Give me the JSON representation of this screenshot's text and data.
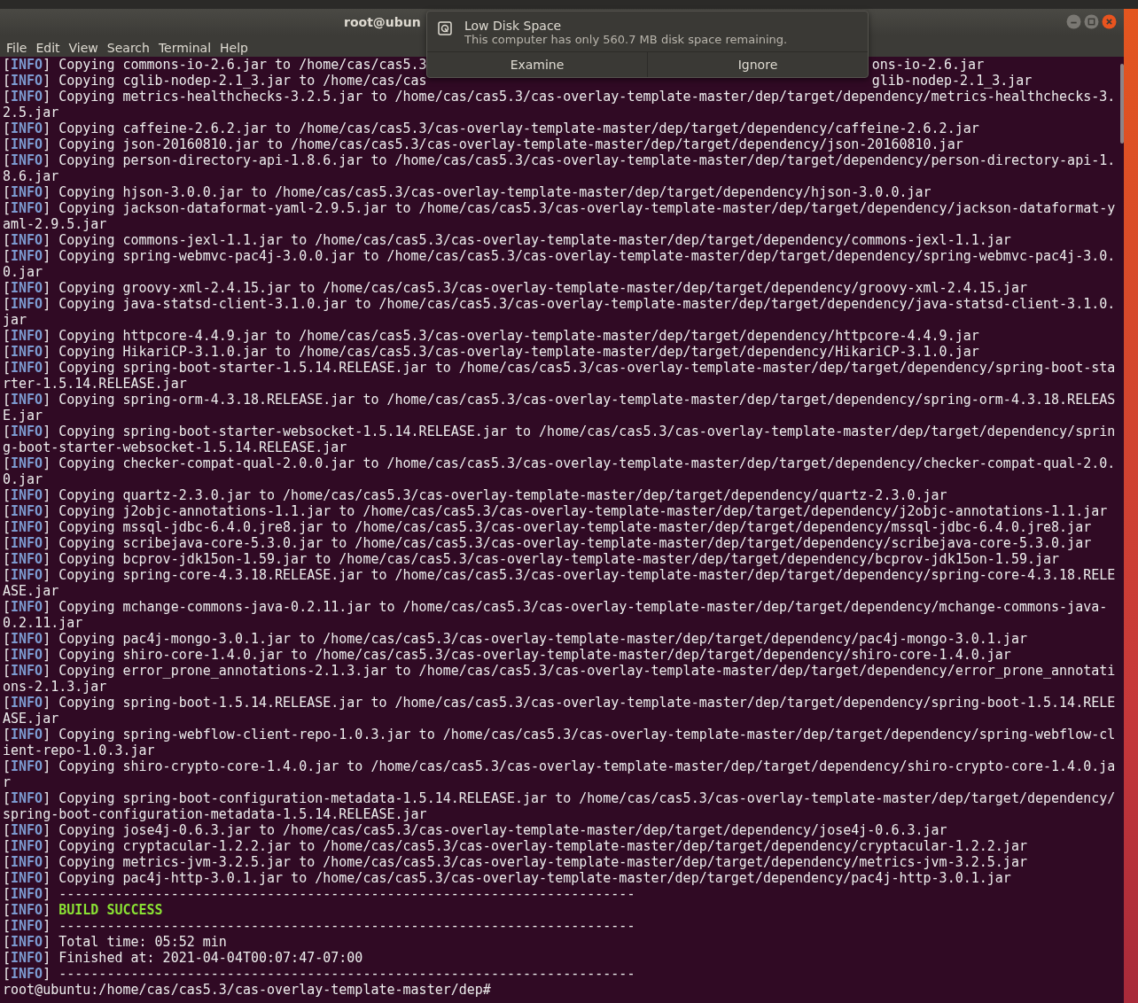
{
  "window": {
    "title": "root@ubun"
  },
  "menu": [
    "File",
    "Edit",
    "View",
    "Search",
    "Terminal",
    "Help"
  ],
  "notification": {
    "title": "Low Disk Space",
    "body": "This computer has only 560.7 MB disk space remaining.",
    "buttons": [
      "Examine",
      "Ignore"
    ]
  },
  "terminal": {
    "lines": [
      {
        "kind": "normal",
        "open": "[",
        "tag": "INFO",
        "close": "]",
        "text": "Copying commons-io-2.6.jar to /home/cas/cas5.3",
        "text_after_popup": "ons-io-2.6.jar"
      },
      {
        "kind": "normal",
        "open": "[",
        "tag": "INFO",
        "close": "]",
        "text": "Copying cglib-nodep-2.1_3.jar to /home/cas/cas",
        "text_after_popup": "glib-nodep-2.1_3.jar"
      },
      {
        "kind": "normal",
        "open": "[",
        "tag": "INFO",
        "close": "]",
        "text": "Copying metrics-healthchecks-3.2.5.jar to /home/cas/cas5.3/cas-overlay-template-master/dep/target/dependency/metrics-healthchecks-3.2.5.jar"
      },
      {
        "kind": "normal",
        "open": "[",
        "tag": "INFO",
        "close": "]",
        "text": "Copying caffeine-2.6.2.jar to /home/cas/cas5.3/cas-overlay-template-master/dep/target/dependency/caffeine-2.6.2.jar"
      },
      {
        "kind": "normal",
        "open": "[",
        "tag": "INFO",
        "close": "]",
        "text": "Copying json-20160810.jar to /home/cas/cas5.3/cas-overlay-template-master/dep/target/dependency/json-20160810.jar"
      },
      {
        "kind": "normal",
        "open": "[",
        "tag": "INFO",
        "close": "]",
        "text": "Copying person-directory-api-1.8.6.jar to /home/cas/cas5.3/cas-overlay-template-master/dep/target/dependency/person-directory-api-1.8.6.jar"
      },
      {
        "kind": "normal",
        "open": "[",
        "tag": "INFO",
        "close": "]",
        "text": "Copying hjson-3.0.0.jar to /home/cas/cas5.3/cas-overlay-template-master/dep/target/dependency/hjson-3.0.0.jar"
      },
      {
        "kind": "normal",
        "open": "[",
        "tag": "INFO",
        "close": "]",
        "text": "Copying jackson-dataformat-yaml-2.9.5.jar to /home/cas/cas5.3/cas-overlay-template-master/dep/target/dependency/jackson-dataformat-yaml-2.9.5.jar"
      },
      {
        "kind": "normal",
        "open": "[",
        "tag": "INFO",
        "close": "]",
        "text": "Copying commons-jexl-1.1.jar to /home/cas/cas5.3/cas-overlay-template-master/dep/target/dependency/commons-jexl-1.1.jar"
      },
      {
        "kind": "normal",
        "open": "[",
        "tag": "INFO",
        "close": "]",
        "text": "Copying spring-webmvc-pac4j-3.0.0.jar to /home/cas/cas5.3/cas-overlay-template-master/dep/target/dependency/spring-webmvc-pac4j-3.0.0.jar"
      },
      {
        "kind": "normal",
        "open": "[",
        "tag": "INFO",
        "close": "]",
        "text": "Copying groovy-xml-2.4.15.jar to /home/cas/cas5.3/cas-overlay-template-master/dep/target/dependency/groovy-xml-2.4.15.jar"
      },
      {
        "kind": "normal",
        "open": "[",
        "tag": "INFO",
        "close": "]",
        "text": "Copying java-statsd-client-3.1.0.jar to /home/cas/cas5.3/cas-overlay-template-master/dep/target/dependency/java-statsd-client-3.1.0.jar"
      },
      {
        "kind": "normal",
        "open": "[",
        "tag": "INFO",
        "close": "]",
        "text": "Copying httpcore-4.4.9.jar to /home/cas/cas5.3/cas-overlay-template-master/dep/target/dependency/httpcore-4.4.9.jar"
      },
      {
        "kind": "normal",
        "open": "[",
        "tag": "INFO",
        "close": "]",
        "text": "Copying HikariCP-3.1.0.jar to /home/cas/cas5.3/cas-overlay-template-master/dep/target/dependency/HikariCP-3.1.0.jar"
      },
      {
        "kind": "normal",
        "open": "[",
        "tag": "INFO",
        "close": "]",
        "text": "Copying spring-boot-starter-1.5.14.RELEASE.jar to /home/cas/cas5.3/cas-overlay-template-master/dep/target/dependency/spring-boot-starter-1.5.14.RELEASE.jar"
      },
      {
        "kind": "normal",
        "open": "[",
        "tag": "INFO",
        "close": "]",
        "text": "Copying spring-orm-4.3.18.RELEASE.jar to /home/cas/cas5.3/cas-overlay-template-master/dep/target/dependency/spring-orm-4.3.18.RELEASE.jar"
      },
      {
        "kind": "normal",
        "open": "[",
        "tag": "INFO",
        "close": "]",
        "text": "Copying spring-boot-starter-websocket-1.5.14.RELEASE.jar to /home/cas/cas5.3/cas-overlay-template-master/dep/target/dependency/spring-boot-starter-websocket-1.5.14.RELEASE.jar"
      },
      {
        "kind": "normal",
        "open": "[",
        "tag": "INFO",
        "close": "]",
        "text": "Copying checker-compat-qual-2.0.0.jar to /home/cas/cas5.3/cas-overlay-template-master/dep/target/dependency/checker-compat-qual-2.0.0.jar"
      },
      {
        "kind": "normal",
        "open": "[",
        "tag": "INFO",
        "close": "]",
        "text": "Copying quartz-2.3.0.jar to /home/cas/cas5.3/cas-overlay-template-master/dep/target/dependency/quartz-2.3.0.jar"
      },
      {
        "kind": "normal",
        "open": "[",
        "tag": "INFO",
        "close": "]",
        "text": "Copying j2objc-annotations-1.1.jar to /home/cas/cas5.3/cas-overlay-template-master/dep/target/dependency/j2objc-annotations-1.1.jar"
      },
      {
        "kind": "normal",
        "open": "[",
        "tag": "INFO",
        "close": "]",
        "text": "Copying mssql-jdbc-6.4.0.jre8.jar to /home/cas/cas5.3/cas-overlay-template-master/dep/target/dependency/mssql-jdbc-6.4.0.jre8.jar"
      },
      {
        "kind": "normal",
        "open": "[",
        "tag": "INFO",
        "close": "]",
        "text": "Copying scribejava-core-5.3.0.jar to /home/cas/cas5.3/cas-overlay-template-master/dep/target/dependency/scribejava-core-5.3.0.jar"
      },
      {
        "kind": "normal",
        "open": "[",
        "tag": "INFO",
        "close": "]",
        "text": "Copying bcprov-jdk15on-1.59.jar to /home/cas/cas5.3/cas-overlay-template-master/dep/target/dependency/bcprov-jdk15on-1.59.jar"
      },
      {
        "kind": "normal",
        "open": "[",
        "tag": "INFO",
        "close": "]",
        "text": "Copying spring-core-4.3.18.RELEASE.jar to /home/cas/cas5.3/cas-overlay-template-master/dep/target/dependency/spring-core-4.3.18.RELEASE.jar"
      },
      {
        "kind": "normal",
        "open": "[",
        "tag": "INFO",
        "close": "]",
        "text": "Copying mchange-commons-java-0.2.11.jar to /home/cas/cas5.3/cas-overlay-template-master/dep/target/dependency/mchange-commons-java-0.2.11.jar"
      },
      {
        "kind": "normal",
        "open": "[",
        "tag": "INFO",
        "close": "]",
        "text": "Copying pac4j-mongo-3.0.1.jar to /home/cas/cas5.3/cas-overlay-template-master/dep/target/dependency/pac4j-mongo-3.0.1.jar"
      },
      {
        "kind": "normal",
        "open": "[",
        "tag": "INFO",
        "close": "]",
        "text": "Copying shiro-core-1.4.0.jar to /home/cas/cas5.3/cas-overlay-template-master/dep/target/dependency/shiro-core-1.4.0.jar"
      },
      {
        "kind": "normal",
        "open": "[",
        "tag": "INFO",
        "close": "]",
        "text": "Copying error_prone_annotations-2.1.3.jar to /home/cas/cas5.3/cas-overlay-template-master/dep/target/dependency/error_prone_annotations-2.1.3.jar"
      },
      {
        "kind": "normal",
        "open": "[",
        "tag": "INFO",
        "close": "]",
        "text": "Copying spring-boot-1.5.14.RELEASE.jar to /home/cas/cas5.3/cas-overlay-template-master/dep/target/dependency/spring-boot-1.5.14.RELEASE.jar"
      },
      {
        "kind": "normal",
        "open": "[",
        "tag": "INFO",
        "close": "]",
        "text": "Copying spring-webflow-client-repo-1.0.3.jar to /home/cas/cas5.3/cas-overlay-template-master/dep/target/dependency/spring-webflow-client-repo-1.0.3.jar"
      },
      {
        "kind": "normal",
        "open": "[",
        "tag": "INFO",
        "close": "]",
        "text": "Copying shiro-crypto-core-1.4.0.jar to /home/cas/cas5.3/cas-overlay-template-master/dep/target/dependency/shiro-crypto-core-1.4.0.jar"
      },
      {
        "kind": "normal",
        "open": "[",
        "tag": "INFO",
        "close": "]",
        "text": "Copying spring-boot-configuration-metadata-1.5.14.RELEASE.jar to /home/cas/cas5.3/cas-overlay-template-master/dep/target/dependency/spring-boot-configuration-metadata-1.5.14.RELEASE.jar"
      },
      {
        "kind": "normal",
        "open": "[",
        "tag": "INFO",
        "close": "]",
        "text": "Copying jose4j-0.6.3.jar to /home/cas/cas5.3/cas-overlay-template-master/dep/target/dependency/jose4j-0.6.3.jar"
      },
      {
        "kind": "normal",
        "open": "[",
        "tag": "INFO",
        "close": "]",
        "text": "Copying cryptacular-1.2.2.jar to /home/cas/cas5.3/cas-overlay-template-master/dep/target/dependency/cryptacular-1.2.2.jar"
      },
      {
        "kind": "normal",
        "open": "[",
        "tag": "INFO",
        "close": "]",
        "text": "Copying metrics-jvm-3.2.5.jar to /home/cas/cas5.3/cas-overlay-template-master/dep/target/dependency/metrics-jvm-3.2.5.jar"
      },
      {
        "kind": "normal",
        "open": "[",
        "tag": "INFO",
        "close": "]",
        "text": "Copying pac4j-http-3.0.1.jar to /home/cas/cas5.3/cas-overlay-template-master/dep/target/dependency/pac4j-http-3.0.1.jar"
      },
      {
        "kind": "normal",
        "open": "[",
        "tag": "INFO",
        "close": "]",
        "text": "------------------------------------------------------------------------"
      },
      {
        "kind": "success",
        "open": "[",
        "tag": "INFO",
        "close": "]",
        "text": "BUILD SUCCESS"
      },
      {
        "kind": "normal",
        "open": "[",
        "tag": "INFO",
        "close": "]",
        "text": "------------------------------------------------------------------------"
      },
      {
        "kind": "normal",
        "open": "[",
        "tag": "INFO",
        "close": "]",
        "text": "Total time: 05:52 min"
      },
      {
        "kind": "normal",
        "open": "[",
        "tag": "INFO",
        "close": "]",
        "text": "Finished at: 2021-04-04T00:07:47-07:00"
      },
      {
        "kind": "normal",
        "open": "[",
        "tag": "INFO",
        "close": "]",
        "text": "------------------------------------------------------------------------"
      }
    ],
    "prompt": "root@ubuntu:/home/cas/cas5.3/cas-overlay-template-master/dep#"
  }
}
